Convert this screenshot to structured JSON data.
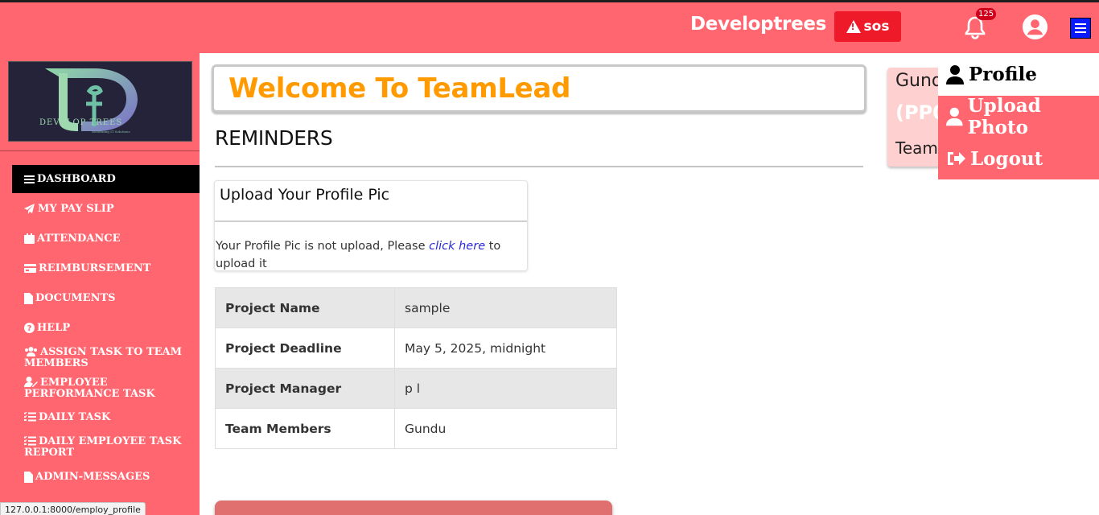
{
  "header": {
    "brand": "Developtrees",
    "sos_label": "sos",
    "notification_count": "125"
  },
  "sidebar": {
    "logo_text": "DEVELOP TREES",
    "logo_tagline": "Redefining IT Solutions",
    "items": [
      {
        "label": "DASHBOARD",
        "icon": "bars-icon",
        "active": true
      },
      {
        "label": "MY PAY SLIP",
        "icon": "paper-plane-icon"
      },
      {
        "label": "ATTENDANCE",
        "icon": "calendar-icon"
      },
      {
        "label": "REIMBURSEMENT",
        "icon": "credit-card-icon"
      },
      {
        "label": "DOCUMENTS",
        "icon": "file-icon"
      },
      {
        "label": "HELP",
        "icon": "question-circle-icon"
      },
      {
        "label": "ASSIGN TASK TO TEAM MEMBERS",
        "icon": "users-icon"
      },
      {
        "label": "EMPLOYEE PERFORMANCE TASK",
        "icon": "user-edit-icon"
      },
      {
        "label": "DAILY TASK",
        "icon": "tasks-icon"
      },
      {
        "label": "DAILY EMPLOYEE TASK REPORT",
        "icon": "tasks-icon"
      },
      {
        "label": "ADMIN-MESSAGES",
        "icon": "file-icon"
      }
    ]
  },
  "main": {
    "welcome": "Welcome To TeamLead",
    "reminders_title": "REMINDERS",
    "upload_card": {
      "title": "Upload Your Profile Pic",
      "text_before": "Your Profile Pic is not upload, Please ",
      "link": "click here",
      "text_after": " to upload it"
    },
    "project": [
      {
        "key": "Project Name",
        "value": "sample"
      },
      {
        "key": "Project Deadline",
        "value": "May 5, 2025, midnight"
      },
      {
        "key": "Project Manager",
        "value": "p l"
      },
      {
        "key": "Team Members",
        "value": "Gundu"
      }
    ]
  },
  "profile_card": {
    "name": "Gund",
    "id": "(PP0",
    "role": "Team"
  },
  "dropdown": {
    "profile": "Profile",
    "upload_photo": "Upload Photo",
    "logout": "Logout"
  },
  "status_bar": {
    "url": "127.0.0.1:8000/employ_profile"
  },
  "colors": {
    "brand": "#ff6670",
    "accent": "#ff9a00",
    "sos": "#ee1a2a"
  }
}
